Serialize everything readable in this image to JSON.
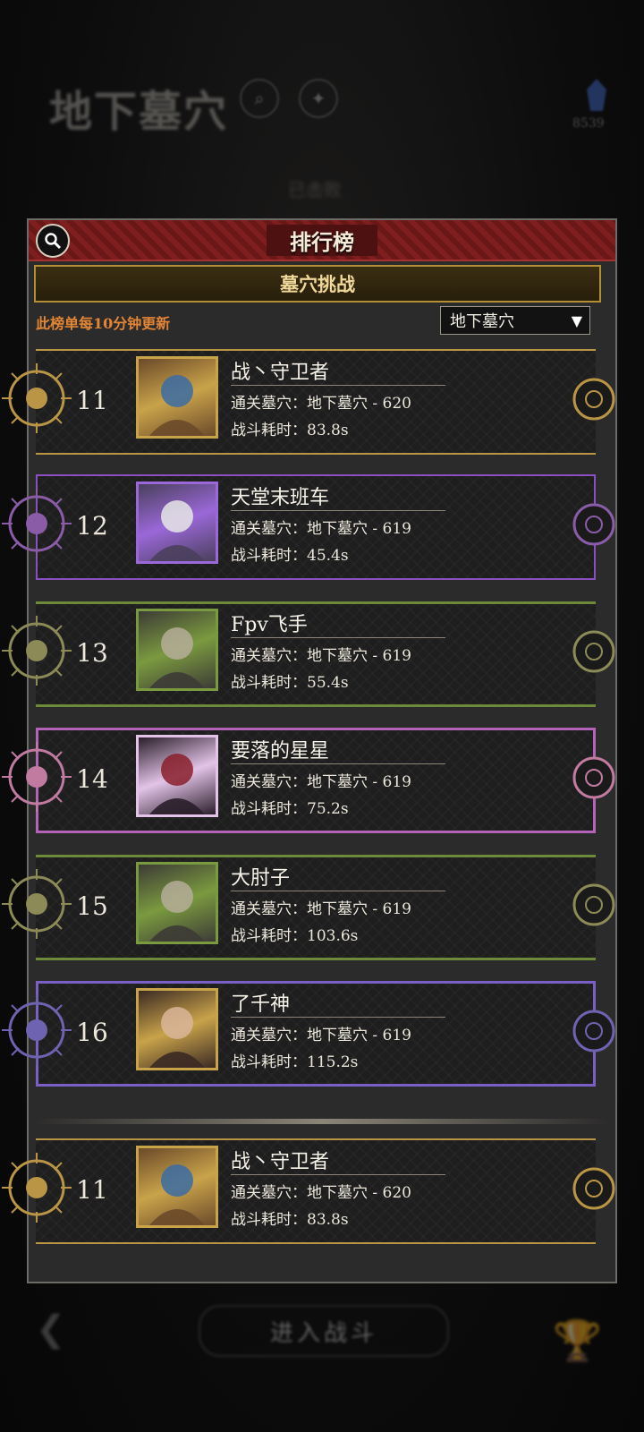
{
  "background": {
    "title": "地下墓穴",
    "currency_count": "8539",
    "status_tag": "已击败",
    "enter_button": "进入战斗"
  },
  "panel": {
    "title": "排行榜",
    "tab_label": "墓穴挑战",
    "notice": "此榜单每10分钟更新",
    "dropdown_value": "地下墓穴",
    "dropdown_arrow": "▼"
  },
  "labels": {
    "cleared_prefix": "通关墓穴：",
    "time_prefix": "战斗耗时："
  },
  "rows": [
    {
      "rank": "11",
      "name": "战丶守卫者",
      "cleared": "地下墓穴 - 620",
      "time": "83.8s",
      "style": "gold"
    },
    {
      "rank": "12",
      "name": "天堂末班车",
      "cleared": "地下墓穴 - 619",
      "time": "45.4s",
      "style": "purple"
    },
    {
      "rank": "13",
      "name": "Fpv飞手",
      "cleared": "地下墓穴 - 619",
      "time": "55.4s",
      "style": "green"
    },
    {
      "rank": "14",
      "name": "要落的星星",
      "cleared": "地下墓穴 - 619",
      "time": "75.2s",
      "style": "pink"
    },
    {
      "rank": "15",
      "name": "大肘子",
      "cleared": "地下墓穴 - 619",
      "time": "103.6s",
      "style": "green"
    },
    {
      "rank": "16",
      "name": "了千神",
      "cleared": "地下墓穴 - 619",
      "time": "115.2s",
      "style": "violet"
    }
  ],
  "self_row": {
    "rank": "11",
    "name": "战丶守卫者",
    "cleared": "地下墓穴 - 620",
    "time": "83.8s",
    "style": "gold"
  },
  "colors": {
    "header_red": "#7f1e1e",
    "tab_gold": "#b38e35",
    "notice_orange": "#e28535",
    "gold": "#b99545",
    "purple": "#8a4fc0",
    "green": "#6c8a3a",
    "pink": "#b364b9",
    "violet": "#7a5fc6"
  }
}
